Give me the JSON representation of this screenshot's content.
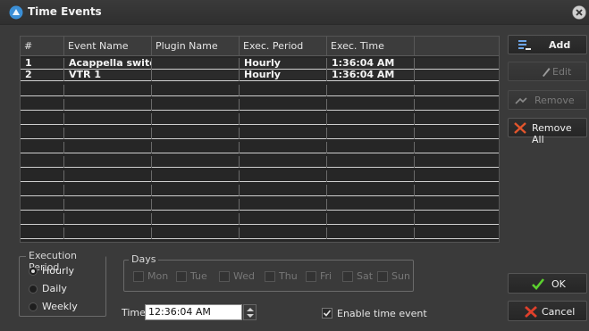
{
  "window": {
    "title": "Time Events"
  },
  "table": {
    "columns": [
      "#",
      "Event Name",
      "Plugin Name",
      "Exec. Period",
      "Exec. Time",
      ""
    ],
    "rows": [
      [
        "1",
        "Acappella switc...",
        "",
        "Hourly",
        "1:36:04 AM",
        ""
      ],
      [
        "2",
        "VTR 1",
        "",
        "Hourly",
        "1:36:04 AM",
        ""
      ]
    ]
  },
  "buttons": {
    "add": "Add",
    "edit": "Edit",
    "remove": "Remove",
    "remove_all": "Remove All",
    "ok": "OK",
    "cancel": "Cancel"
  },
  "execution_period": {
    "title": "Execution Period",
    "options": [
      "Hourly",
      "Daily",
      "Weekly"
    ],
    "selected": "Hourly"
  },
  "days": {
    "title": "Days",
    "options": [
      "Mon",
      "Tue",
      "Wed",
      "Thu",
      "Fri",
      "Sat",
      "Sun"
    ]
  },
  "time": {
    "label": "Time",
    "value": "12:36:04 AM"
  },
  "enable_time_event": {
    "label": "Enable time event",
    "checked": true
  },
  "colors": {
    "background": "#3a3a3a",
    "grid_background": "#262626",
    "accent_add": "#5a8fd8",
    "ok_check": "#5bd12e",
    "cancel_x": "#e0402b",
    "remove_all_x": "#e2552c"
  }
}
